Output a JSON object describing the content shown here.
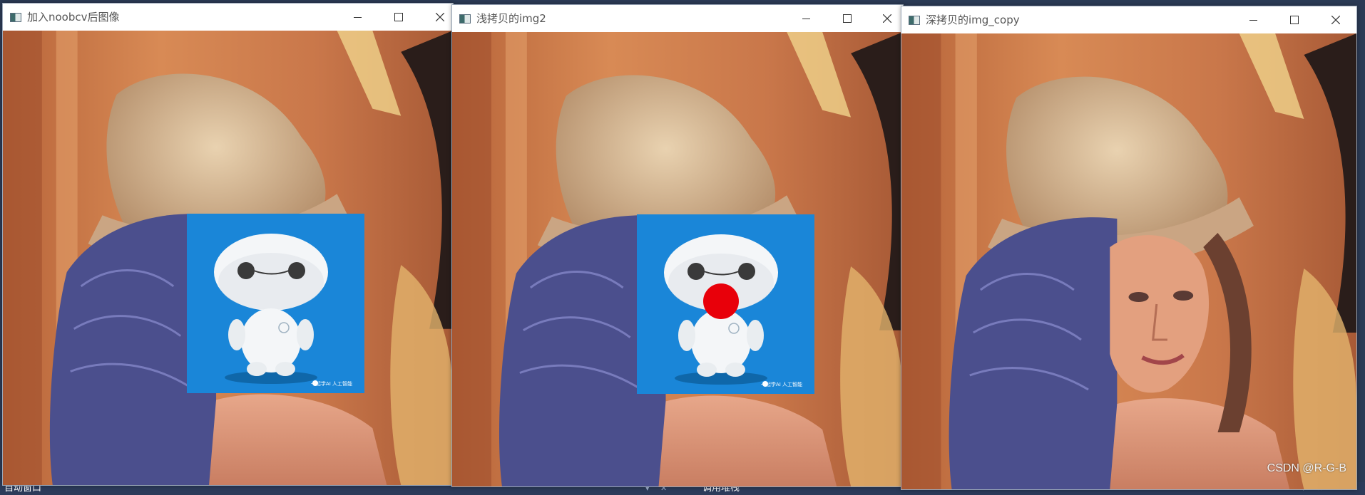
{
  "windows": [
    {
      "title": "加入noobcv后图像",
      "overlay": "robot",
      "nose": false
    },
    {
      "title": "浅拷贝的img2",
      "overlay": "robot",
      "nose": true
    },
    {
      "title": "深拷贝的img_copy",
      "overlay": "face",
      "nose": false
    }
  ],
  "window_icons": [
    "app-icon",
    "minimize-icon",
    "maximize-icon",
    "close-icon"
  ],
  "robot_caption": "一起学AI 人工智能",
  "ide": {
    "left_tab": "自动窗口",
    "right_tab": "调用堆栈",
    "pins": "▾ ✕"
  },
  "watermark": "CSDN @R-G-B",
  "colors": {
    "robot_bg": "#1a86d8",
    "nose": "#e8000a"
  }
}
